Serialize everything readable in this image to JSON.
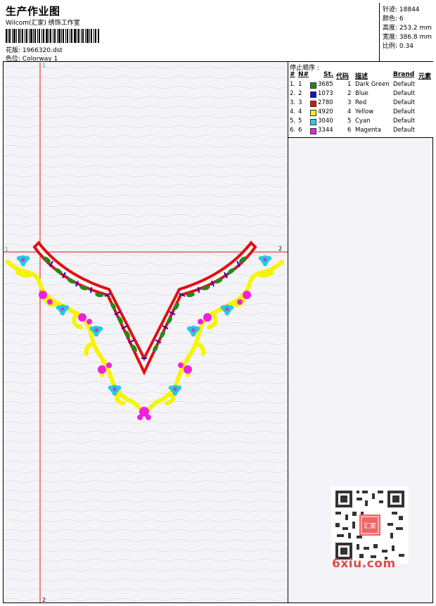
{
  "header": {
    "title": "生产作业图",
    "subtitle": "Wilcom(汇家) 绣饰工作室",
    "design_label": "花版:",
    "design_value": "1966320.dst",
    "colorway_label": "色位:",
    "colorway_value": "Colorway 1"
  },
  "stats": {
    "stitches": "针迹: 18844",
    "colors": "颜色: 6",
    "height": "高度: 253.2 mm",
    "width": "宽度: 386.8 mm",
    "scale": "比例: 0.34"
  },
  "legend": {
    "title": "停止顺序 :",
    "columns": [
      "#",
      "N#",
      "St.",
      "代码",
      "描述",
      "Brand",
      "元素"
    ],
    "rows": [
      {
        "num": "1.",
        "n": "1",
        "st": "3685",
        "code": "1",
        "desc": "Dark Green",
        "brand": "Default",
        "color": "#1e8a1e"
      },
      {
        "num": "2.",
        "n": "2",
        "st": "1073",
        "code": "2",
        "desc": "Blue",
        "brand": "Default",
        "color": "#1010d0"
      },
      {
        "num": "3.",
        "n": "3",
        "st": "2780",
        "code": "3",
        "desc": "Red",
        "brand": "Default",
        "color": "#e01010"
      },
      {
        "num": "4.",
        "n": "4",
        "st": "4920",
        "code": "4",
        "desc": "Yellow",
        "brand": "Default",
        "color": "#f5f500"
      },
      {
        "num": "5.",
        "n": "5",
        "st": "3040",
        "code": "5",
        "desc": "Cyan",
        "brand": "Default",
        "color": "#20d0e0"
      },
      {
        "num": "6.",
        "n": "6",
        "st": "3344",
        "code": "6",
        "desc": "Magenta",
        "brand": "Default",
        "color": "#f020e0"
      }
    ]
  },
  "axes": {
    "v_top": "1",
    "v_bottom": "2",
    "h_left": "1",
    "h_right": "2"
  },
  "watermark": {
    "text": "6xiu.com",
    "stamp": "汇家"
  }
}
